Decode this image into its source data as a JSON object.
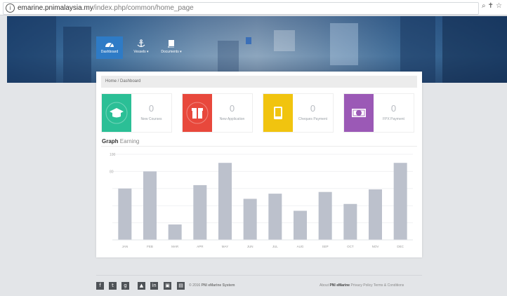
{
  "browser": {
    "url_domain": "emarine.pnimalaysia.my",
    "url_path": "/index.php/common/home_page",
    "info_glyph": "i",
    "icons": [
      "zoom-icon",
      "key-icon",
      "star-icon"
    ]
  },
  "nav": [
    {
      "label": "Dashboard",
      "icon": "dashboard-icon",
      "active": true
    },
    {
      "label": "Vessels ▾",
      "icon": "anchor-icon",
      "active": false
    },
    {
      "label": "Documents ▾",
      "icon": "book-icon",
      "active": false
    }
  ],
  "breadcrumb": "Home  /  Dashboard",
  "stats": [
    {
      "value": "0",
      "label": "New Courses",
      "color": "#2bbf96",
      "icon": "graduation-cap-icon"
    },
    {
      "value": "0",
      "label": "New Application",
      "color": "#e8483c",
      "icon": "gift-icon"
    },
    {
      "value": "0",
      "label": "Cheques Payment",
      "color": "#f1c40f",
      "icon": "tablet-icon"
    },
    {
      "value": "0",
      "label": "FPX Payment",
      "color": "#9b59b6",
      "icon": "money-icon"
    }
  ],
  "graph": {
    "title": "Graph",
    "subtitle": "Earning"
  },
  "chart_data": {
    "type": "bar",
    "categories": [
      "JAN",
      "FEB",
      "MAR",
      "APR",
      "MAY",
      "JUN",
      "JUL",
      "AUG",
      "SEP",
      "OCT",
      "NOV",
      "DEC"
    ],
    "values": [
      60,
      80,
      18,
      64,
      90,
      48,
      54,
      34,
      56,
      42,
      59,
      90
    ],
    "ylim": [
      0,
      100
    ],
    "yticks": [
      0,
      20,
      40,
      60,
      80,
      100
    ],
    "ylabels": [
      "",
      "",
      "",
      "",
      "80",
      "100"
    ],
    "bar_color": "#bcc1cc",
    "grid": true
  },
  "footer": {
    "social": [
      "f",
      "t",
      "g",
      "▲",
      "in",
      "▣",
      "▤"
    ],
    "copyright_prefix": "© 2016",
    "company": "PNI eMarine System",
    "about": "About",
    "about_name": "PNI eMarine",
    "links": "Privacy Policy  Terms & Conditions"
  }
}
